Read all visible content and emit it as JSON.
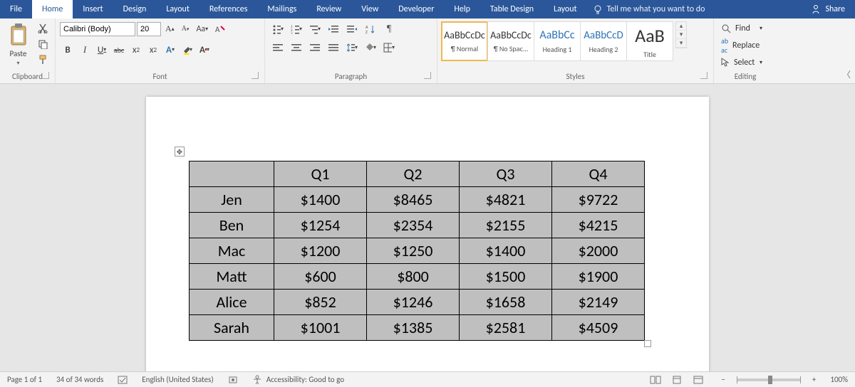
{
  "menu": {
    "tabs": [
      "File",
      "Home",
      "Insert",
      "Design",
      "Layout",
      "References",
      "Mailings",
      "Review",
      "View",
      "Developer",
      "Help",
      "Table Design",
      "Layout"
    ],
    "active": "Home",
    "tellme": "Tell me what you want to do",
    "share": "Share"
  },
  "ribbon": {
    "clipboard": {
      "label": "Clipboard",
      "paste": "Paste"
    },
    "font": {
      "label": "Font",
      "name": "Calibri (Body)",
      "size": "20",
      "bold": "B",
      "italic": "I",
      "underline": "U",
      "strike": "abc",
      "sub": "x",
      "sup": "x",
      "caseAa": "Aa",
      "clear": "◊"
    },
    "paragraph": {
      "label": "Paragraph"
    },
    "styles": {
      "label": "Styles",
      "items": [
        {
          "preview": "AaBbCcDc",
          "name": "¶ Normal",
          "size": "14",
          "color": "#333"
        },
        {
          "preview": "AaBbCcDc",
          "name": "¶ No Spac...",
          "size": "14",
          "color": "#333"
        },
        {
          "preview": "AaBbCc",
          "name": "Heading 1",
          "size": "16",
          "color": "#2e74b5"
        },
        {
          "preview": "AaBbCcD",
          "name": "Heading 2",
          "size": "15",
          "color": "#2e74b5"
        },
        {
          "preview": "AaB",
          "name": "Title",
          "size": "26",
          "color": "#333"
        }
      ]
    },
    "editing": {
      "label": "Editing",
      "find": "Find",
      "replace": "Replace",
      "select": "Select"
    }
  },
  "chart_data": {
    "type": "table",
    "title": "",
    "columns": [
      "",
      "Q1",
      "Q2",
      "Q3",
      "Q4"
    ],
    "rows": [
      {
        "name": "Jen",
        "values": [
          "$1400",
          "$8465",
          "$4821",
          "$9722"
        ]
      },
      {
        "name": "Ben",
        "values": [
          "$1254",
          "$2354",
          "$2155",
          "$4215"
        ]
      },
      {
        "name": "Mac",
        "values": [
          "$1200",
          "$1250",
          "$1400",
          "$2000"
        ]
      },
      {
        "name": "Matt",
        "values": [
          "$600",
          "$800",
          "$1500",
          "$1900"
        ]
      },
      {
        "name": "Alice",
        "values": [
          "$852",
          "$1246",
          "$1658",
          "$2149"
        ]
      },
      {
        "name": "Sarah",
        "values": [
          "$1001",
          "$1385",
          "$2581",
          "$4509"
        ]
      }
    ]
  },
  "status": {
    "page": "Page 1 of 1",
    "words": "34 of 34 words",
    "lang": "English (United States)",
    "accessibility": "Accessibility: Good to go",
    "zoom": "100%"
  }
}
